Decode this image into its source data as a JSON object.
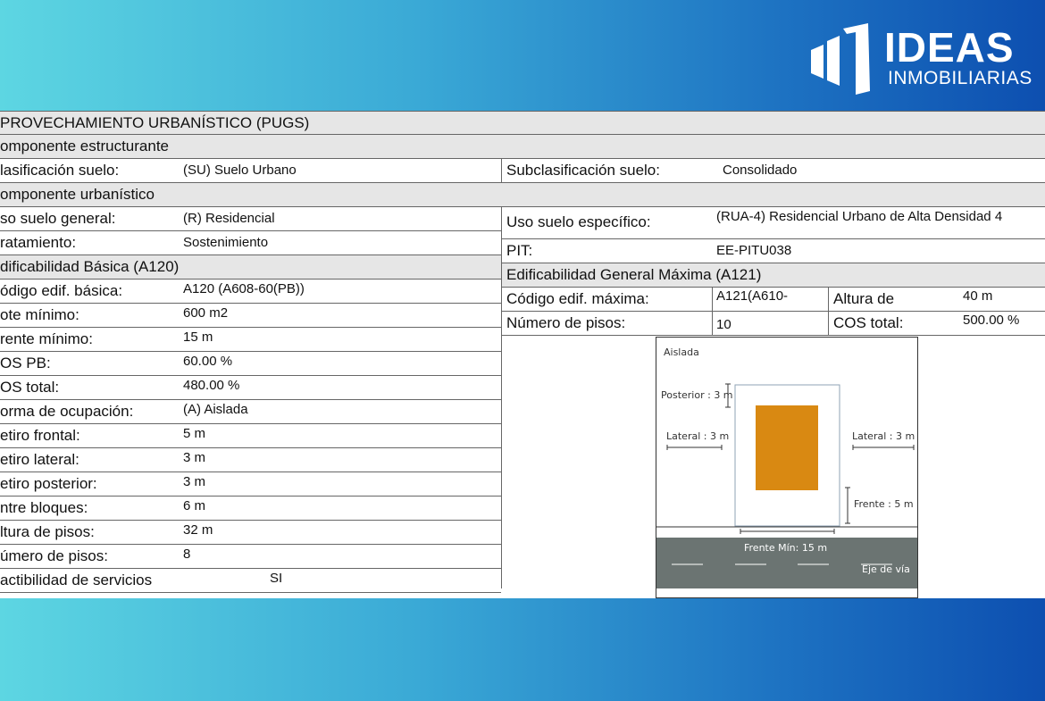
{
  "brand": {
    "name": "IDEAS",
    "sub": "INMOBILIARIAS"
  },
  "sheet": {
    "title": "PROVECHAMIENTO URBANÍSTICO (PUGS)",
    "componente_estructurante": "omponente  estructurante",
    "clasificacion_label": "lasificación suelo:",
    "clasificacion_value": "(SU) Suelo Urbano",
    "subclasificacion_label": "Subclasificación suelo:",
    "subclasificacion_value": "Consolidado",
    "componente_urbanistico": "omponente  urbanístico",
    "uso_general_label": "so suelo general:",
    "uso_general_value": "(R) Residencial",
    "uso_especifico_label": "Uso suelo específico:",
    "uso_especifico_value": "(RUA-4) Residencial Urbano de Alta Densidad 4",
    "tratamiento_label": "ratamiento:",
    "tratamiento_value": "Sostenimiento",
    "pit_label": "PIT:",
    "pit_value": "EE-PITU038",
    "edif_basica_header": "dificabilidad Básica (A120)",
    "edif_general_header": "Edificabilidad General Máxima (A121)",
    "left_rows": [
      {
        "label": "ódigo edif. básica:",
        "value": "A120 (A608-60(PB))"
      },
      {
        "label": "ote mínimo:",
        "value": "600 m2"
      },
      {
        "label": "rente mínimo:",
        "value": "15 m"
      },
      {
        "label": "OS PB:",
        "value": "60.00 %"
      },
      {
        "label": "OS total:",
        "value": "480.00 %"
      },
      {
        "label": "orma de ocupación:",
        "value": "(A) Aislada"
      },
      {
        "label": "etiro frontal:",
        "value": "5 m"
      },
      {
        "label": "etiro lateral:",
        "value": "3 m"
      },
      {
        "label": "etiro posterior:",
        "value": "3 m"
      },
      {
        "label": "ntre bloques:",
        "value": "6 m"
      },
      {
        "label": "ltura de pisos:",
        "value": "32 m"
      },
      {
        "label": "úmero de pisos:",
        "value": "8"
      },
      {
        "label": "actibilidad de servicios",
        "value": "SI"
      }
    ],
    "codigo_max_label": "Código edif. máxima:",
    "codigo_max_value": "A121(A610-",
    "altura_label": "Altura de",
    "altura_value": "40 m",
    "num_pisos_label": "Número de pisos:",
    "num_pisos_value": "10",
    "cos_total_label": "COS total:",
    "cos_total_value": "500.00 %"
  },
  "diagram": {
    "aislada": "Aislada",
    "posterior": "Posterior : 3 m",
    "lateral_left": "Lateral : 3 m",
    "lateral_right": "Lateral : 3 m",
    "frente": "Frente : 5 m",
    "frente_min": "Frente Mín: 15 m",
    "eje_via": "Eje de vía",
    "building_color": "#d98912",
    "road_color": "#6b7472"
  }
}
